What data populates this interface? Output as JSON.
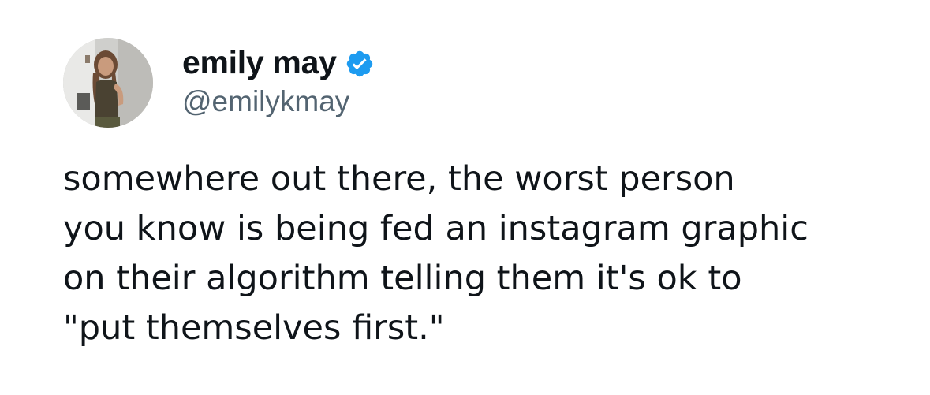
{
  "author": {
    "display_name": "emily may",
    "handle": "@emilykmay",
    "verified": true,
    "verified_icon": "verified-badge-icon",
    "verified_color": "#1d9bf0"
  },
  "tweet": {
    "lines": [
      "somewhere out there, the worst person",
      "you know is being fed an instagram graphic",
      "on their algorithm telling them it's ok to",
      "\"put themselves first.\""
    ]
  },
  "colors": {
    "text": "#0f1419",
    "secondary_text": "#536471",
    "background": "#ffffff"
  }
}
